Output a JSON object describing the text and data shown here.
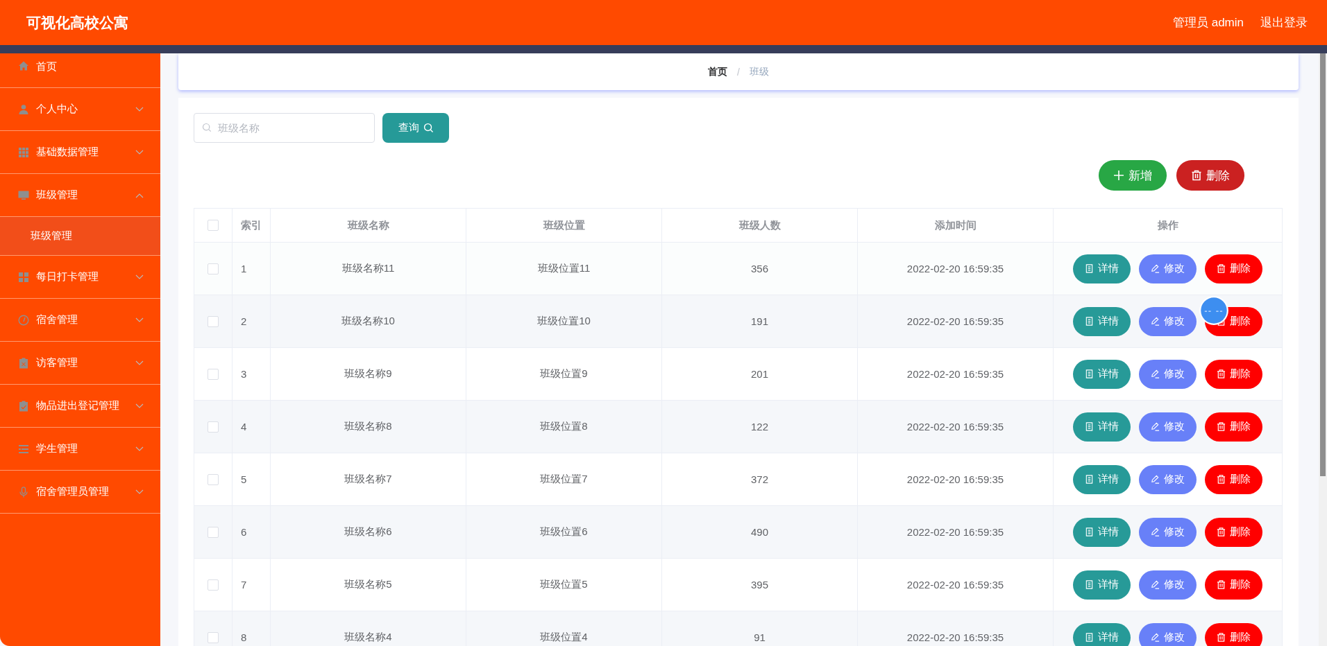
{
  "header": {
    "title": "可视化高校公寓",
    "user": "管理员 admin",
    "logout": "退出登录"
  },
  "sidebar": {
    "items": [
      {
        "label": "首页"
      },
      {
        "label": "个人中心",
        "expanded": false
      },
      {
        "label": "基础数据管理",
        "expanded": false
      },
      {
        "label": "班级管理",
        "expanded": true,
        "children": [
          {
            "label": "班级管理",
            "selected": true
          }
        ]
      },
      {
        "label": "每日打卡管理",
        "expanded": false
      },
      {
        "label": "宿舍管理",
        "expanded": false
      },
      {
        "label": "访客管理",
        "expanded": false
      },
      {
        "label": "物品进出登记管理",
        "expanded": false
      },
      {
        "label": "学生管理",
        "expanded": false
      },
      {
        "label": "宿舍管理员管理",
        "expanded": false
      }
    ]
  },
  "breadcrumb": [
    {
      "label": "首页",
      "current": false
    },
    {
      "label": "/",
      "kind": "separator"
    },
    {
      "label": "班级",
      "current": true
    }
  ],
  "search": {
    "placeholder": "班级名称",
    "button": "查询"
  },
  "toolbar": [
    {
      "label": "新增",
      "kind": "add"
    },
    {
      "label": "删除",
      "kind": "delete"
    }
  ],
  "table": {
    "select_all_checked": false,
    "columns": [
      "索引",
      "班级名称",
      "班级位置",
      "班级人数",
      "添加时间",
      "操作"
    ],
    "rows": [
      {
        "checked": false,
        "index": "1",
        "name": "班级名称11",
        "position": "班级位置11",
        "count": "356",
        "time": "2022-02-20 16:59:35",
        "actions": [
          {
            "label": "详情",
            "kind": "detail"
          },
          {
            "label": "修改",
            "kind": "edit"
          },
          {
            "label": "删除",
            "kind": "delete"
          }
        ]
      },
      {
        "checked": false,
        "index": "2",
        "name": "班级名称10",
        "position": "班级位置10",
        "count": "191",
        "time": "2022-02-20 16:59:35",
        "actions": [
          {
            "label": "详情",
            "kind": "detail"
          },
          {
            "label": "修改",
            "kind": "edit"
          },
          {
            "label": "删除",
            "kind": "delete"
          }
        ]
      },
      {
        "checked": false,
        "index": "3",
        "name": "班级名称9",
        "position": "班级位置9",
        "count": "201",
        "time": "2022-02-20 16:59:35",
        "actions": [
          {
            "label": "详情",
            "kind": "detail"
          },
          {
            "label": "修改",
            "kind": "edit"
          },
          {
            "label": "删除",
            "kind": "delete"
          }
        ]
      },
      {
        "checked": false,
        "index": "4",
        "name": "班级名称8",
        "position": "班级位置8",
        "count": "122",
        "time": "2022-02-20 16:59:35",
        "actions": [
          {
            "label": "详情",
            "kind": "detail"
          },
          {
            "label": "修改",
            "kind": "edit"
          },
          {
            "label": "删除",
            "kind": "delete"
          }
        ]
      },
      {
        "checked": false,
        "index": "5",
        "name": "班级名称7",
        "position": "班级位置7",
        "count": "372",
        "time": "2022-02-20 16:59:35",
        "actions": [
          {
            "label": "详情",
            "kind": "detail"
          },
          {
            "label": "修改",
            "kind": "edit"
          },
          {
            "label": "删除",
            "kind": "delete"
          }
        ]
      },
      {
        "checked": false,
        "index": "6",
        "name": "班级名称6",
        "position": "班级位置6",
        "count": "490",
        "time": "2022-02-20 16:59:35",
        "actions": [
          {
            "label": "详情",
            "kind": "detail"
          },
          {
            "label": "修改",
            "kind": "edit"
          },
          {
            "label": "删除",
            "kind": "delete"
          }
        ]
      },
      {
        "checked": false,
        "index": "7",
        "name": "班级名称5",
        "position": "班级位置5",
        "count": "395",
        "time": "2022-02-20 16:59:35",
        "actions": [
          {
            "label": "详情",
            "kind": "detail"
          },
          {
            "label": "修改",
            "kind": "edit"
          },
          {
            "label": "删除",
            "kind": "delete"
          }
        ]
      },
      {
        "checked": false,
        "index": "8",
        "name": "班级名称4",
        "position": "班级位置4",
        "count": "91",
        "time": "2022-02-20 16:59:35",
        "actions": [
          {
            "label": "详情",
            "kind": "detail"
          },
          {
            "label": "修改",
            "kind": "edit"
          },
          {
            "label": "删除",
            "kind": "delete"
          }
        ]
      }
    ]
  }
}
